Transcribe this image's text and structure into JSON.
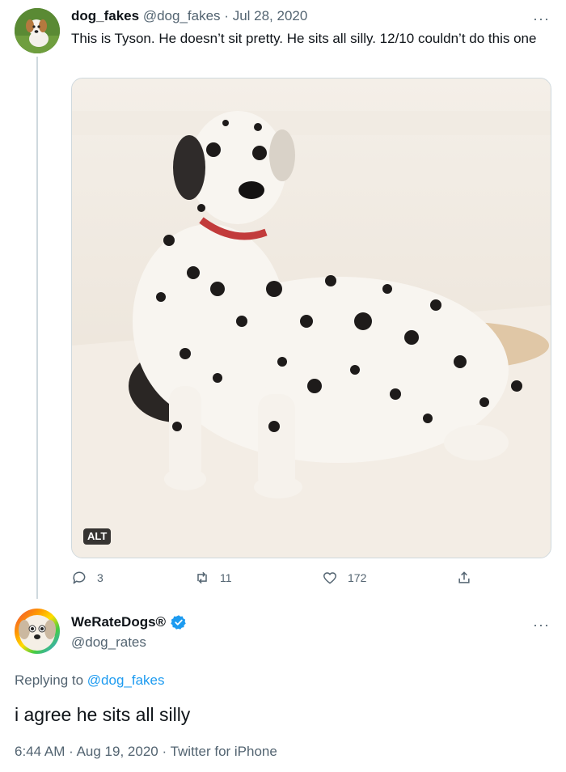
{
  "tweet1": {
    "display_name": "dog_fakes",
    "handle": "@dog_fakes",
    "separator": "·",
    "date": "Jul 28, 2020",
    "text": "This is Tyson. He doesn’t sit pretty. He sits all silly. 12/10 couldn’t do this one",
    "more": "···",
    "alt_label": "ALT",
    "replies": "3",
    "retweets": "11",
    "likes": "172",
    "avatar_icon": "dog-avatar-icon",
    "image_icon": "dalmatian-photo"
  },
  "tweet2": {
    "display_name": "WeRateDogs®",
    "handle": "@dog_rates",
    "verified_color": "#1d9bf0",
    "more": "···",
    "replying_prefix": "Replying to",
    "replying_to": "@dog_fakes",
    "text": "i agree he sits all silly",
    "time": "6:44 AM",
    "separator": "·",
    "date": "Aug 19, 2020",
    "separator2": "·",
    "source": "Twitter for iPhone"
  },
  "colors": {
    "text": "#0f1419",
    "secondary": "#536471",
    "accent": "#1d9bf0",
    "thread_line": "#cfd9de"
  }
}
